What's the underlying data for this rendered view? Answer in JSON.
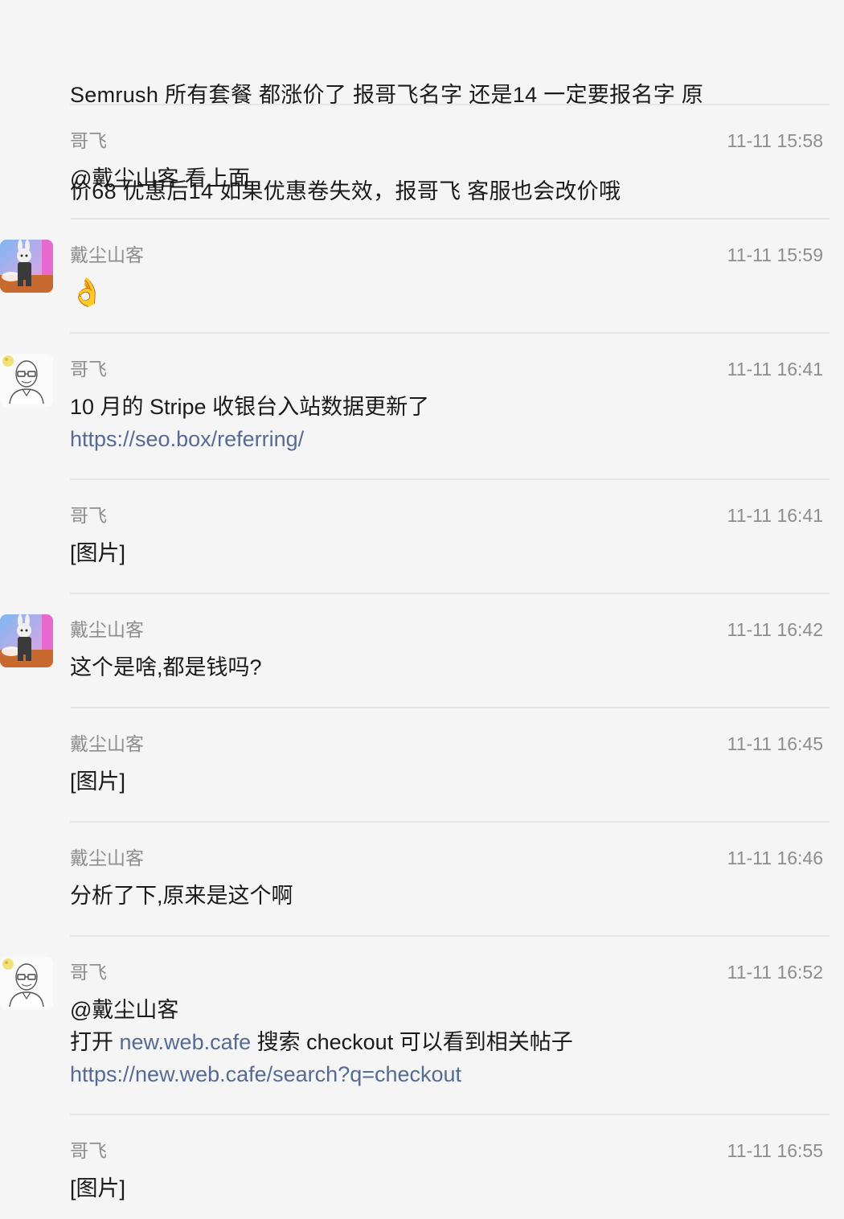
{
  "top_message": {
    "line1": "Semrush   所有套餐 都涨价了   报哥飞名字  还是14      一定要报名字    原",
    "line2": "价68  优惠后14       如果优惠卷失效，报哥飞  客服也会改价哦"
  },
  "messages": [
    {
      "sender": "哥飞",
      "time": "11-11 15:58",
      "text": "@戴尘山客 看上面"
    },
    {
      "sender": "戴尘山客",
      "time": "11-11 15:59",
      "emoji": "👌"
    },
    {
      "sender": "哥飞",
      "time": "11-11 16:41",
      "text": "10 月的 Stripe 收银台入站数据更新了",
      "link": "https://seo.box/referring/"
    },
    {
      "sender": "哥飞",
      "time": "11-11 16:41",
      "text": "[图片]"
    },
    {
      "sender": "戴尘山客",
      "time": "11-11 16:42",
      "text": "这个是啥,都是钱吗?"
    },
    {
      "sender": "戴尘山客",
      "time": "11-11 16:45",
      "text": "[图片]"
    },
    {
      "sender": "戴尘山客",
      "time": "11-11 16:46",
      "text": "分析了下,原来是这个啊"
    },
    {
      "sender": "哥飞",
      "time": "11-11 16:52",
      "line1": "@戴尘山客",
      "line2_pre": "打开 ",
      "line2_link": "new.web.cafe",
      "line2_post": " 搜索 checkout 可以看到相关帖子",
      "link": "https://new.web.cafe/search?q=checkout"
    },
    {
      "sender": "哥飞",
      "time": "11-11 16:55",
      "text": "[图片]"
    }
  ]
}
